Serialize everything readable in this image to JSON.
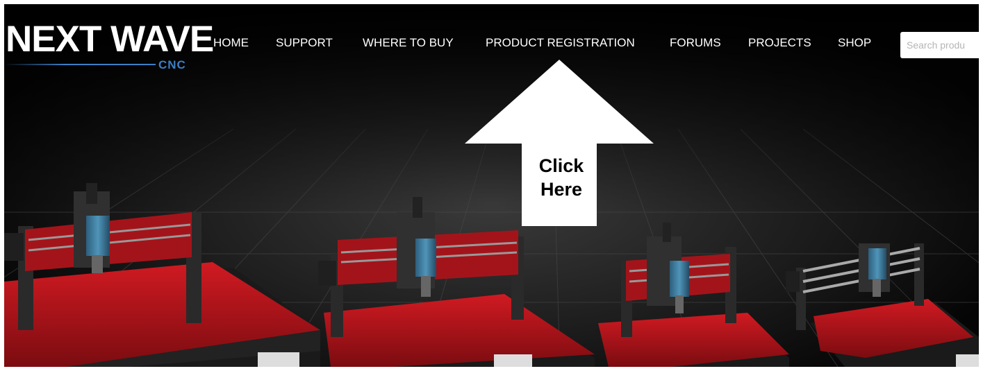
{
  "brand": {
    "name": "NEXT WAVE",
    "sub": "CNC"
  },
  "nav": {
    "items": [
      {
        "label": "HOME"
      },
      {
        "label": "SUPPORT"
      },
      {
        "label": "WHERE TO BUY"
      },
      {
        "label": "PRODUCT REGISTRATION"
      },
      {
        "label": "FORUMS"
      },
      {
        "label": "PROJECTS"
      },
      {
        "label": "SHOP"
      }
    ]
  },
  "search": {
    "placeholder": "Search produ"
  },
  "callout": {
    "line1": "Click",
    "line2": "Here"
  },
  "colors": {
    "accent": "#3d7ec4",
    "machine_red": "#b8141b",
    "background": "#000000"
  }
}
